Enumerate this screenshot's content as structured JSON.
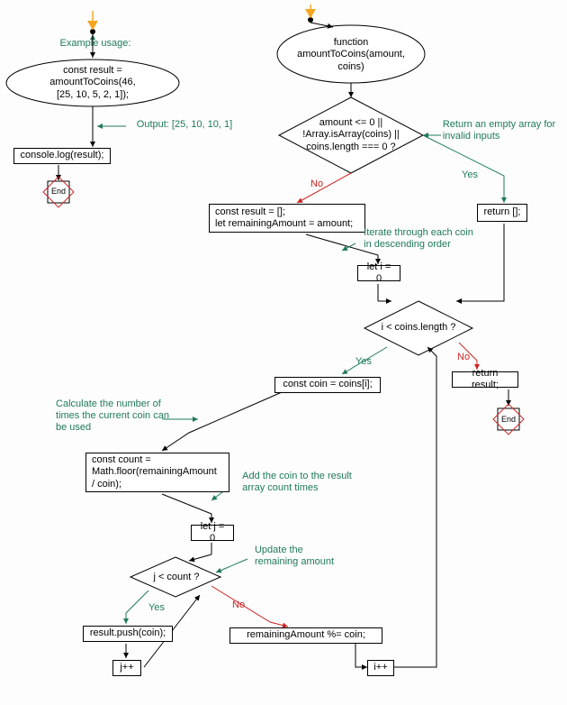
{
  "comments": {
    "example_usage": "Example usage:",
    "output": "Output: [25, 10, 10, 1]",
    "invalid_inputs": "Return an empty array for\ninvalid inputs",
    "iterate": "Iterate through each coin\nin descending order",
    "calc_count": "Calculate the number of\ntimes the current coin can\nbe used",
    "add_coin": "Add the coin to the result\narray count times",
    "update_remaining": "Update the\nremaining amount"
  },
  "nodes": {
    "func_decl": "function\namountToCoins(amount,\ncoins)",
    "example_call": "const result = amountToCoins(46,\n[25, 10, 5, 2, 1]);",
    "console_log": "console.log(result);",
    "end1": "End",
    "guard": "amount <= 0 ||\n!Array.isArray(coins) ||\ncoins.length === 0 ?",
    "return_empty": "return [];",
    "init_result": "const result = [];\nlet remainingAmount = amount;",
    "let_i": "let i = 0",
    "i_cond": "i < coins.length ?",
    "return_result": "return result;",
    "end2": "End",
    "coin_assign": "const coin = coins[i];",
    "count_calc": "const count =\nMath.floor(remainingAmount\n/ coin);",
    "let_j": "let j = 0",
    "j_cond": "j < count ?",
    "push": "result.push(coin);",
    "jpp": "j++",
    "mod": "remainingAmount %= coin;",
    "ipp": "i++"
  },
  "labels": {
    "yes": "Yes",
    "no": "No"
  }
}
